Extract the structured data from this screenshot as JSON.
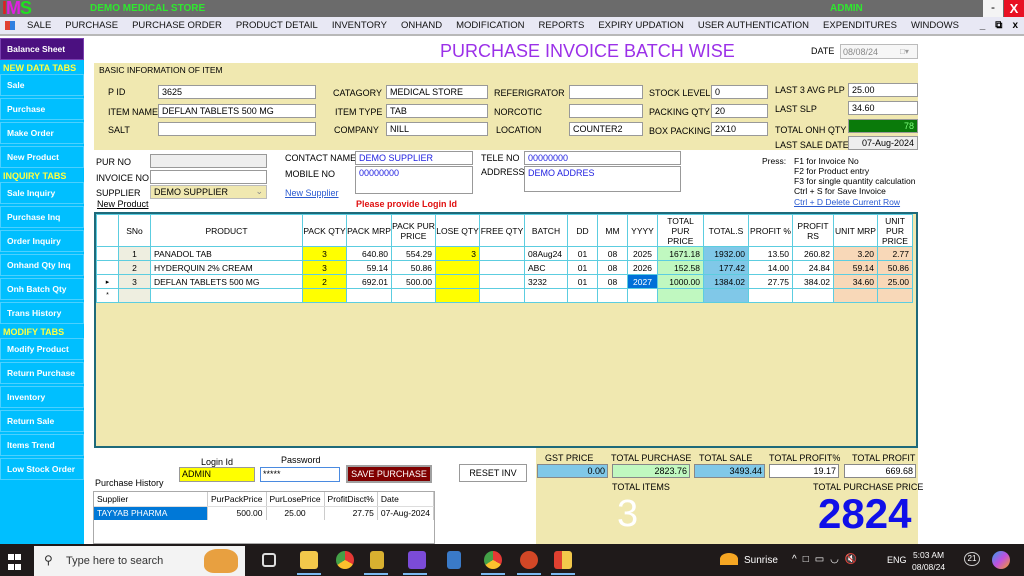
{
  "app": {
    "logo": {
      "i": "I",
      "m": "M",
      "s": "S"
    },
    "store_name": "DEMO MEDICAL STORE",
    "user": "ADMIN",
    "window_min": "-",
    "window_close": "X"
  },
  "menu": {
    "items": [
      "SALE",
      "PURCHASE",
      "PURCHASE ORDER",
      "PRODUCT DETAIL",
      "INVENTORY",
      "ONHAND",
      "MODIFICATION",
      "REPORTS",
      "EXPIRY UPDATION",
      "USER AUTHENTICATION",
      "EXPENDITURES",
      "WINDOWS"
    ],
    "mdi_min": "_",
    "mdi_restore": "⧉",
    "mdi_close": "x"
  },
  "sidebar": {
    "balance_sheet": "Balance Sheet",
    "new_data_heading": "NEW DATA TABS",
    "new_data": [
      "Sale",
      "Purchase",
      "Make Order",
      "New Product"
    ],
    "inquiry_heading": "INQUIRY TABS",
    "inquiry": [
      "Sale Inquiry",
      "Purchase Inq",
      "Order Inquiry",
      "Onhand Qty Inq",
      "Onh Batch Qty",
      "Trans History"
    ],
    "modify_heading": "MODIFY TABS",
    "modify": [
      "Modify Product",
      "Return Purchase",
      "Inventory",
      "Return Sale",
      "Items Trend",
      "Low Stock Order"
    ]
  },
  "page": {
    "title": "PURCHASE INVOICE BATCH WISE",
    "date_label": "DATE",
    "date_value": "08/08/24"
  },
  "basic_info": {
    "caption": "BASIC INFORMATION OF ITEM",
    "pid_label": "P ID",
    "pid": "3625",
    "item_name_label": "ITEM NAME",
    "item_name": "DEFLAN TABLETS 500 MG",
    "salt_label": "SALT",
    "salt": "",
    "category_label": "CATAGORY",
    "category": "MEDICAL STORE",
    "item_type_label": "ITEM TYPE",
    "item_type": "TAB",
    "company_label": "COMPANY",
    "company": "NILL",
    "refrigerator_label": "REFERIGRATOR",
    "refrigerator": "",
    "narcotic_label": "NORCOTIC",
    "narcotic": "",
    "location_label": "LOCATION",
    "location": "COUNTER2",
    "stock_level_label": "STOCK LEVEL",
    "stock_level": "0",
    "packing_qty_label": "PACKING QTY",
    "packing_qty": "20",
    "box_packing_label": "BOX PACKING",
    "box_packing": "2X10",
    "last3_avg_plp_label": "LAST 3 AVG PLP",
    "last3_avg_plp": "25.00",
    "last_slp_label": "LAST SLP",
    "last_slp": "34.60",
    "total_onh_qty_label": "TOTAL ONH QTY",
    "total_onh_qty": "78",
    "last_sale_date_label": "LAST SALE DATE",
    "last_sale_date": "07-Aug-2024"
  },
  "purchase": {
    "pur_no_label": "PUR NO",
    "pur_no": "",
    "invoice_no_label": "INVOICE NO",
    "invoice_no": "",
    "supplier_label": "SUPPLIER",
    "supplier": "DEMO SUPPLIER",
    "new_product_link": "New Product",
    "contact_name_label": "CONTACT NAME",
    "contact_name": "DEMO SUPPLIER",
    "mobile_no_label": "MOBILE NO",
    "mobile_no": "00000000",
    "new_supplier_link": "New Supplier",
    "tele_no_label": "TELE NO",
    "tele_no": "00000000",
    "address_label": "ADDRESS",
    "address": "DEMO ADDRES",
    "login_warning": "Please provide Login Id"
  },
  "hints": {
    "press": "Press:",
    "lines": [
      "F1 for Invoice No",
      "F2 for Product entry",
      "F3 for single quantity calculation",
      "Ctrl + S for Save Invoice"
    ],
    "delete_link": "Ctrl + D Delete Current Row"
  },
  "grid": {
    "headers": [
      "SNo",
      "PRODUCT",
      "PACK QTY",
      "PACK MRP",
      "PACK PUR PRICE",
      "LOSE QTY",
      "FREE QTY",
      "BATCH",
      "DD",
      "MM",
      "YYYY",
      "TOTAL PUR PRICE",
      "TOTAL.S",
      "PROFIT %",
      "PROFIT RS",
      "UNIT MRP",
      "UNIT PUR PRICE"
    ],
    "rows": [
      {
        "marker": "",
        "sno": "1",
        "product": "PANADOL TAB",
        "pack_qty": "3",
        "pack_mrp": "640.80",
        "pack_pur": "554.29",
        "lose_qty": "3",
        "free_qty": "",
        "batch": "08Aug24",
        "dd": "01",
        "mm": "08",
        "yyyy": "2025",
        "total_pur": "1671.18",
        "total_s": "1932.00",
        "profit_pct": "13.50",
        "profit_rs": "260.82",
        "unit_mrp": "3.20",
        "unit_pur": "2.77"
      },
      {
        "marker": "",
        "sno": "2",
        "product": "HYDERQUIN 2% CREAM",
        "pack_qty": "3",
        "pack_mrp": "59.14",
        "pack_pur": "50.86",
        "lose_qty": "",
        "free_qty": "",
        "batch": "ABC",
        "dd": "01",
        "mm": "08",
        "yyyy": "2026",
        "total_pur": "152.58",
        "total_s": "177.42",
        "profit_pct": "14.00",
        "profit_rs": "24.84",
        "unit_mrp": "59.14",
        "unit_pur": "50.86"
      },
      {
        "marker": "▸",
        "sno": "3",
        "product": "DEFLAN TABLETS 500 MG",
        "pack_qty": "2",
        "pack_mrp": "692.01",
        "pack_pur": "500.00",
        "lose_qty": "",
        "free_qty": "",
        "batch": "3232",
        "dd": "01",
        "mm": "08",
        "yyyy": "2027",
        "total_pur": "1000.00",
        "total_s": "1384.02",
        "profit_pct": "27.75",
        "profit_rs": "384.02",
        "unit_mrp": "34.60",
        "unit_pur": "25.00"
      },
      {
        "marker": "*",
        "sno": "",
        "product": "",
        "pack_qty": "",
        "pack_mrp": "",
        "pack_pur": "",
        "lose_qty": "",
        "free_qty": "",
        "batch": "",
        "dd": "",
        "mm": "",
        "yyyy": "",
        "total_pur": "",
        "total_s": "",
        "profit_pct": "",
        "profit_rs": "",
        "unit_mrp": "",
        "unit_pur": ""
      }
    ]
  },
  "login": {
    "login_id_label": "Login Id",
    "login_id": "ADMIN",
    "password_label": "Password",
    "password": "*****",
    "save_button": "SAVE PURCHASE",
    "reset_button": "RESET INV"
  },
  "history": {
    "label": "Purchase History",
    "headers": [
      "Supplier",
      "PurPackPrice",
      "PurLosePrice",
      "ProfitDisct%",
      "Date"
    ],
    "rows": [
      {
        "supplier": "TAYYAB PHARMA",
        "pack": "500.00",
        "lose": "25.00",
        "profit": "27.75",
        "date": "07-Aug-2024"
      }
    ]
  },
  "totals": {
    "gst_price_label": "GST PRICE",
    "gst_price": "0.00",
    "total_purchase_label": "TOTAL PURCHASE",
    "total_purchase": "2823.76",
    "total_sale_label": "TOTAL SALE",
    "total_sale": "3493.44",
    "total_profit_pct_label": "TOTAL PROFIT%",
    "total_profit_pct": "19.17",
    "total_profit_label": "TOTAL PROFIT",
    "total_profit": "669.68",
    "total_items_label": "TOTAL ITEMS",
    "total_items": "3",
    "total_purchase_price_label": "TOTAL PURCHASE PRICE",
    "total_purchase_price": "2824"
  },
  "taskbar": {
    "search_placeholder": "Type here to search",
    "weather": "Sunrise",
    "language": "ENG",
    "time": "5:03 AM",
    "date": "08/08/24",
    "notifications": "21",
    "colors": {
      "chrome": "#2f9e44",
      "vs": "#7b4bd8",
      "ppt": "#d24726",
      "explorer": "#f2c84b"
    }
  }
}
